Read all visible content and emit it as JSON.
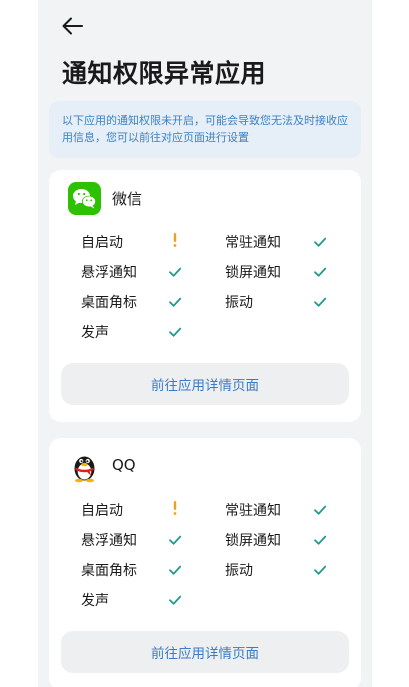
{
  "page": {
    "title": "通知权限异常应用",
    "notice": "以下应用的通知权限未开启，可能会导致您无法及时接收应用信息，您可以前往对应页面进行设置"
  },
  "colors": {
    "accent": "#3a7bc8",
    "check": "#1f9a8c",
    "warning": "#f0a020",
    "wechat": "#2dc100"
  },
  "apps": [
    {
      "name": "微信",
      "icon": "wechat-icon",
      "permissions": [
        {
          "label": "自启动",
          "status": "warning"
        },
        {
          "label": "常驻通知",
          "status": "ok"
        },
        {
          "label": "悬浮通知",
          "status": "ok"
        },
        {
          "label": "锁屏通知",
          "status": "ok"
        },
        {
          "label": "桌面角标",
          "status": "ok"
        },
        {
          "label": "振动",
          "status": "ok"
        },
        {
          "label": "发声",
          "status": "ok"
        }
      ],
      "button_label": "前往应用详情页面"
    },
    {
      "name": "QQ",
      "icon": "qq-penguin-icon",
      "permissions": [
        {
          "label": "自启动",
          "status": "warning"
        },
        {
          "label": "常驻通知",
          "status": "ok"
        },
        {
          "label": "悬浮通知",
          "status": "ok"
        },
        {
          "label": "锁屏通知",
          "status": "ok"
        },
        {
          "label": "桌面角标",
          "status": "ok"
        },
        {
          "label": "振动",
          "status": "ok"
        },
        {
          "label": "发声",
          "status": "ok"
        }
      ],
      "button_label": "前往应用详情页面"
    }
  ]
}
